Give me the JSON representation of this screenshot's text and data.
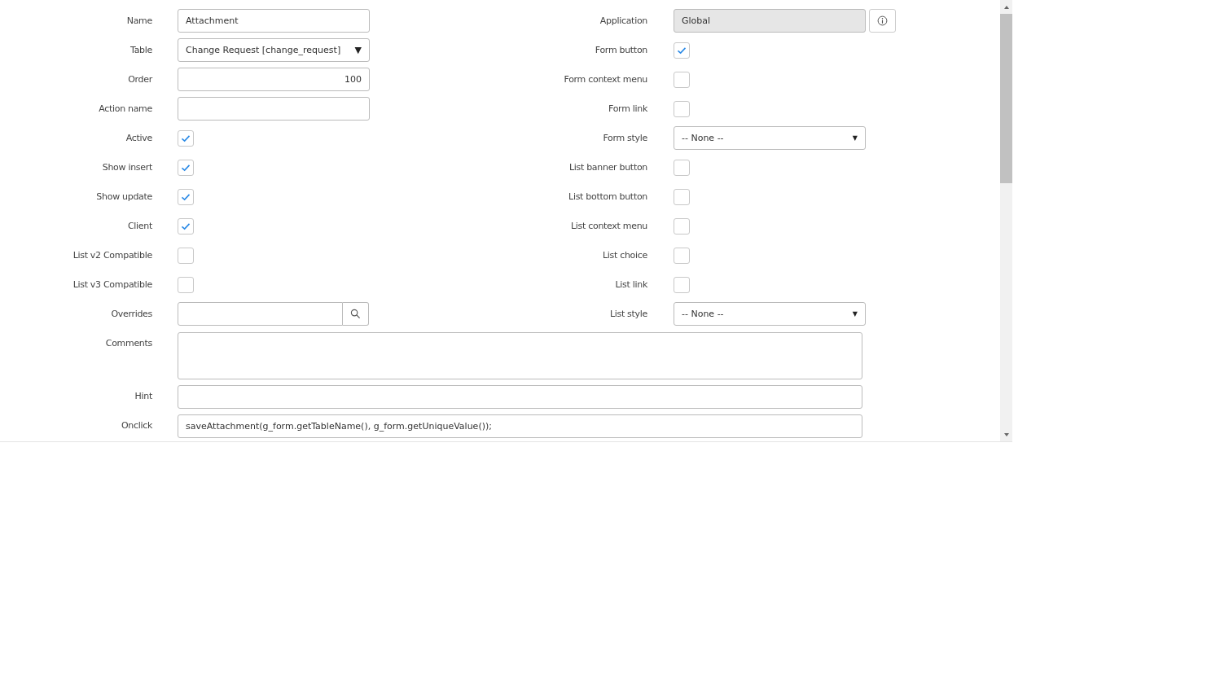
{
  "left_fields": [
    {
      "kind": "text",
      "label": "Name",
      "value": "Attachment"
    },
    {
      "kind": "select",
      "label": "Table",
      "value": "Change Request [change_request]",
      "caret": "▼"
    },
    {
      "kind": "number",
      "label": "Order",
      "value": "100"
    },
    {
      "kind": "text",
      "label": "Action name"
    },
    {
      "kind": "checkbox",
      "label": "Active",
      "checked": true
    },
    {
      "kind": "checkbox",
      "label": "Show insert",
      "checked": true
    },
    {
      "kind": "checkbox",
      "label": "Show update",
      "checked": true
    },
    {
      "kind": "checkbox",
      "label": "Client",
      "checked": true
    },
    {
      "kind": "checkbox",
      "label": "List v2 Compatible",
      "checked": false
    },
    {
      "kind": "checkbox",
      "label": "List v3 Compatible",
      "checked": false
    },
    {
      "kind": "reference",
      "label": "Overrides"
    }
  ],
  "right_fields": [
    {
      "kind": "readonly",
      "label": "Application",
      "value": "Global"
    },
    {
      "kind": "checkbox",
      "label": "Form button",
      "checked": true
    },
    {
      "kind": "checkbox",
      "label": "Form context menu",
      "checked": false
    },
    {
      "kind": "checkbox",
      "label": "Form link",
      "checked": false
    },
    {
      "kind": "select",
      "label": "Form style",
      "value": "-- None --",
      "caret": "▼"
    },
    {
      "kind": "checkbox",
      "label": "List banner button",
      "checked": false
    },
    {
      "kind": "checkbox",
      "label": "List bottom button",
      "checked": false
    },
    {
      "kind": "checkbox",
      "label": "List context menu",
      "checked": false
    },
    {
      "kind": "checkbox",
      "label": "List choice",
      "checked": false
    },
    {
      "kind": "checkbox",
      "label": "List link",
      "checked": false
    },
    {
      "kind": "select",
      "label": "List style",
      "value": "-- None --",
      "caret": "▼"
    }
  ],
  "full_fields": [
    {
      "kind": "textarea",
      "label": "Comments"
    },
    {
      "kind": "text",
      "label": "Hint"
    },
    {
      "kind": "text",
      "label": "Onclick",
      "value": "saveAttachment(g_form.getTableName(), g_form.getUniqueValue());"
    }
  ]
}
